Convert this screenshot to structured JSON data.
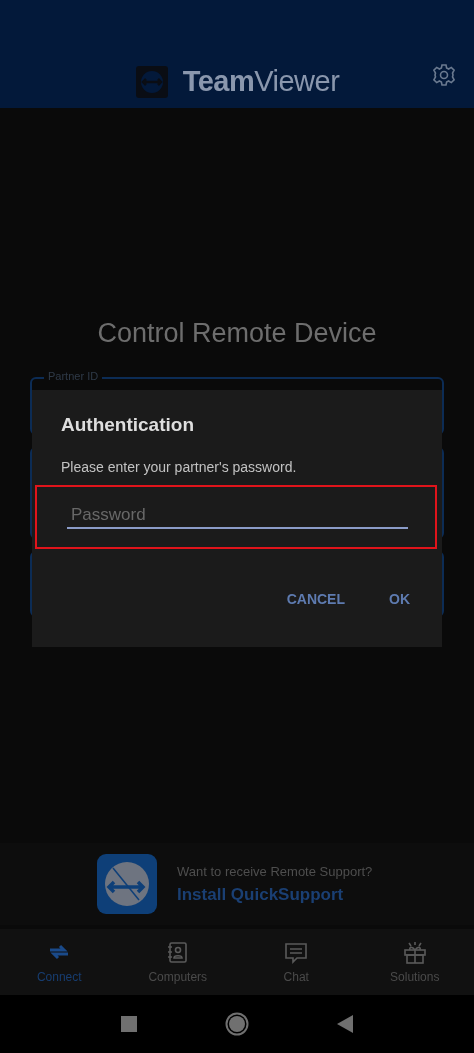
{
  "header": {
    "brand": "**Team**Viewer"
  },
  "title": "Control Remote Device",
  "fields": [
    {
      "label": "Partner ID"
    }
  ],
  "dialog": {
    "title": "Authentication",
    "message": "Please enter your partner's password.",
    "password": {
      "placeholder": "Password"
    },
    "highlighted": true,
    "buttons": [
      "CANCEL",
      "OK"
    ]
  },
  "promo": {
    "question": "Want to receive Remote Support?",
    "link": "Install QuickSupport"
  },
  "tabs": [
    {
      "label": "Connect",
      "kind": "connect",
      "selected": true
    },
    {
      "label": "Computers",
      "kind": "computers",
      "selected": false
    },
    {
      "label": "Chat",
      "kind": "chat",
      "selected": false
    },
    {
      "label": "Solutions",
      "kind": "solutions",
      "selected": false
    }
  ]
}
